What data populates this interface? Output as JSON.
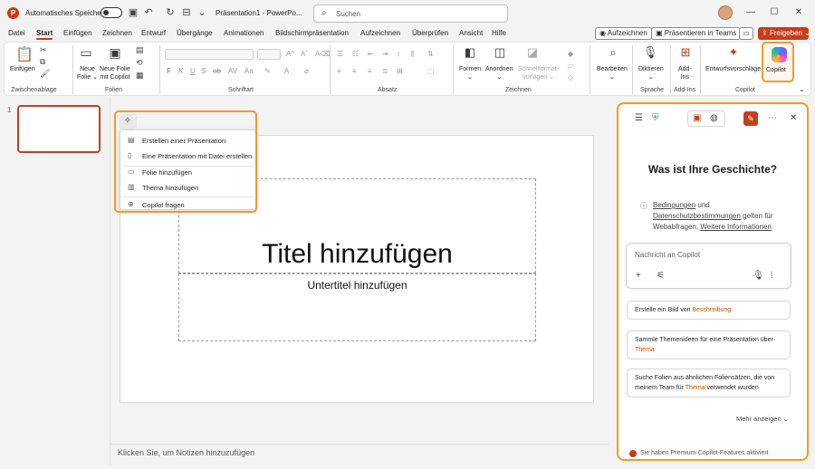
{
  "titlebar": {
    "autosave_label": "Automatisches Speichern",
    "doc_title": "Präsentation1 - PowerPo...",
    "search_placeholder": "Suchen"
  },
  "menu": {
    "items": [
      "Datei",
      "Start",
      "Einfügen",
      "Zeichnen",
      "Entwurf",
      "Übergänge",
      "Animationen",
      "Bildschirmpräsentation",
      "Aufzeichnen",
      "Überprüfen",
      "Ansicht",
      "Hilfe"
    ],
    "active": "Start",
    "record_btn": "Aufzeichnen",
    "teams_btn": "Präsentieren in Teams",
    "share_btn": "Freigeben"
  },
  "ribbon": {
    "groups": {
      "clipboard": "Zwischenablage",
      "slides": "Folien",
      "font": "Schriftart",
      "paragraph": "Absatz",
      "drawing": "Zeichnen",
      "voice": "Sprache",
      "addins": "Add-Ins",
      "copilot": "Copilot"
    },
    "paste": "Einfügen",
    "new_slide_1": "Neue",
    "new_slide_2": "Folie",
    "new_copilot_1": "Neue Folie",
    "new_copilot_2": "mit Copilot",
    "shapes": "Formen",
    "arrange": "Anordnen",
    "quick_styles_1": "Schnellformat-",
    "quick_styles_2": "vorlagen",
    "edit": "Bearbeiten",
    "dictate": "Diktieren",
    "addins_1": "Add-",
    "addins_2": "Ins",
    "designer": "Entwurfsvorschläge",
    "copilot": "Copilot"
  },
  "slides": {
    "number": "1"
  },
  "slide": {
    "title_placeholder": "Titel hinzufügen",
    "subtitle_placeholder": "Untertitel hinzufügen"
  },
  "notes": "Klicken Sie, um Notizen hinzuzufügen",
  "copilot_menu": {
    "items": [
      "Erstellen einer Präsentation",
      "Eine Präsentation mit Datei erstellen",
      "Folie hinzufügen",
      "Thema hinzufügen",
      "Copilot fragen"
    ]
  },
  "copilot_panel": {
    "heading": "Was ist Ihre Geschichte?",
    "info_terms": "Bedingungen",
    "info_and": " und ",
    "info_privacy": "Datenschutzbestimmungen",
    "info_rest": " gelten für Webabfragen. ",
    "info_more": "Weitere Informationen",
    "input_placeholder": "Nachricht an Copilot",
    "cards": [
      {
        "text": "Erstelle ein Bild von ",
        "hl": "Beschreibung"
      },
      {
        "text": "Sammle Themenideen für eine Präsentation über ",
        "hl": "Thema"
      },
      {
        "text": "Suche Folien aus ähnlichen Foliensätzen, die von meinem Team für ",
        "hl": "Thema",
        "after": " verwendet wurden"
      }
    ],
    "show_more": "Mehr anzeigen",
    "premium": "Sie haben Premium-Copilot-Features aktiviert"
  },
  "colors": {
    "accent": "#c43e1c",
    "highlight": "#f59a23"
  }
}
